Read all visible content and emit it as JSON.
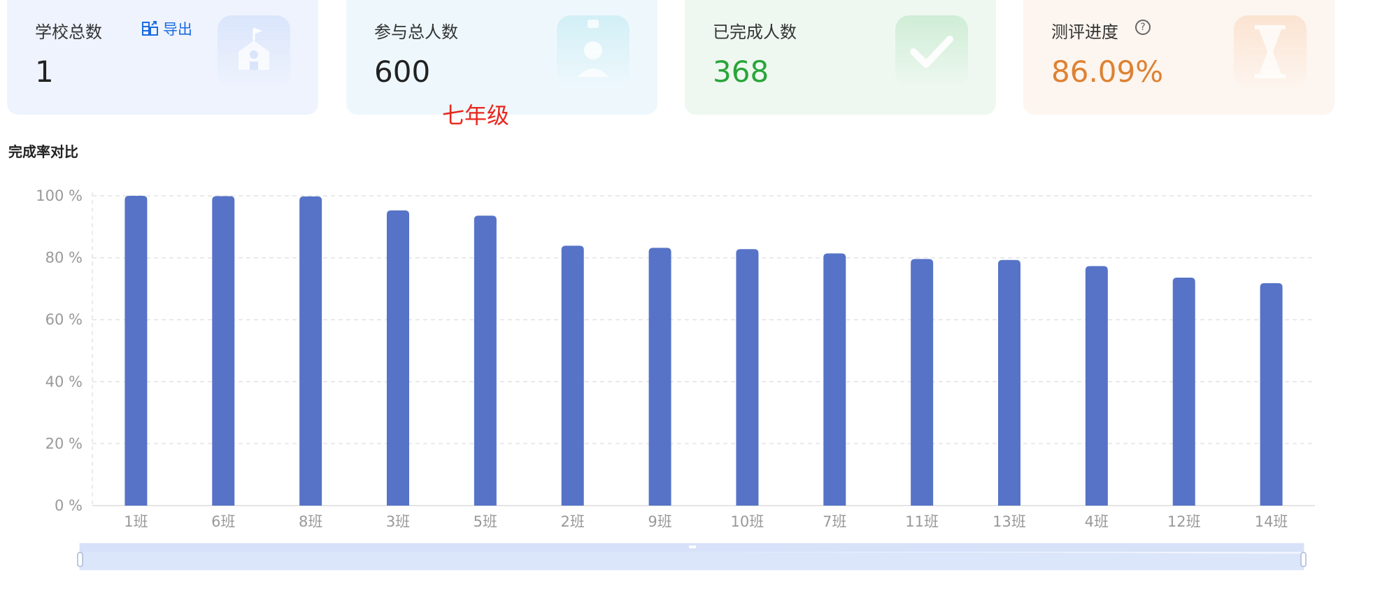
{
  "cards": {
    "schools": {
      "title": "学校总数",
      "value": "1",
      "export_label": "导出",
      "icon": "school-icon"
    },
    "participants": {
      "title": "参与总人数",
      "value": "600",
      "icon": "id-badge-icon"
    },
    "completed": {
      "title": "已完成人数",
      "value": "368",
      "icon": "check-icon",
      "color": "#2aa53a"
    },
    "progress": {
      "title": "测评进度",
      "value": "86.09%",
      "icon": "hourglass-icon",
      "color": "#dd8233",
      "help_icon": "question-circle-icon"
    }
  },
  "grade_label": "七年级",
  "chart_title": "完成率对比",
  "colors": {
    "bar": "#5673c7",
    "slider": "#dce6fb"
  },
  "chart_data": {
    "type": "bar",
    "title": "完成率对比",
    "categories": [
      "1班",
      "6班",
      "8班",
      "3班",
      "5班",
      "2班",
      "9班",
      "10班",
      "7班",
      "11班",
      "13班",
      "4班",
      "12班",
      "14班"
    ],
    "values": [
      100,
      99.9,
      99.8,
      95.3,
      93.6,
      83.9,
      83.2,
      82.8,
      81.4,
      79.6,
      79.3,
      77.3,
      73.6,
      71.8
    ],
    "y_ticks": [
      "0 %",
      "20 %",
      "40 %",
      "60 %",
      "80 %",
      "100 %"
    ],
    "ylim": [
      0,
      100
    ],
    "grid": true,
    "dataZoom": true
  }
}
